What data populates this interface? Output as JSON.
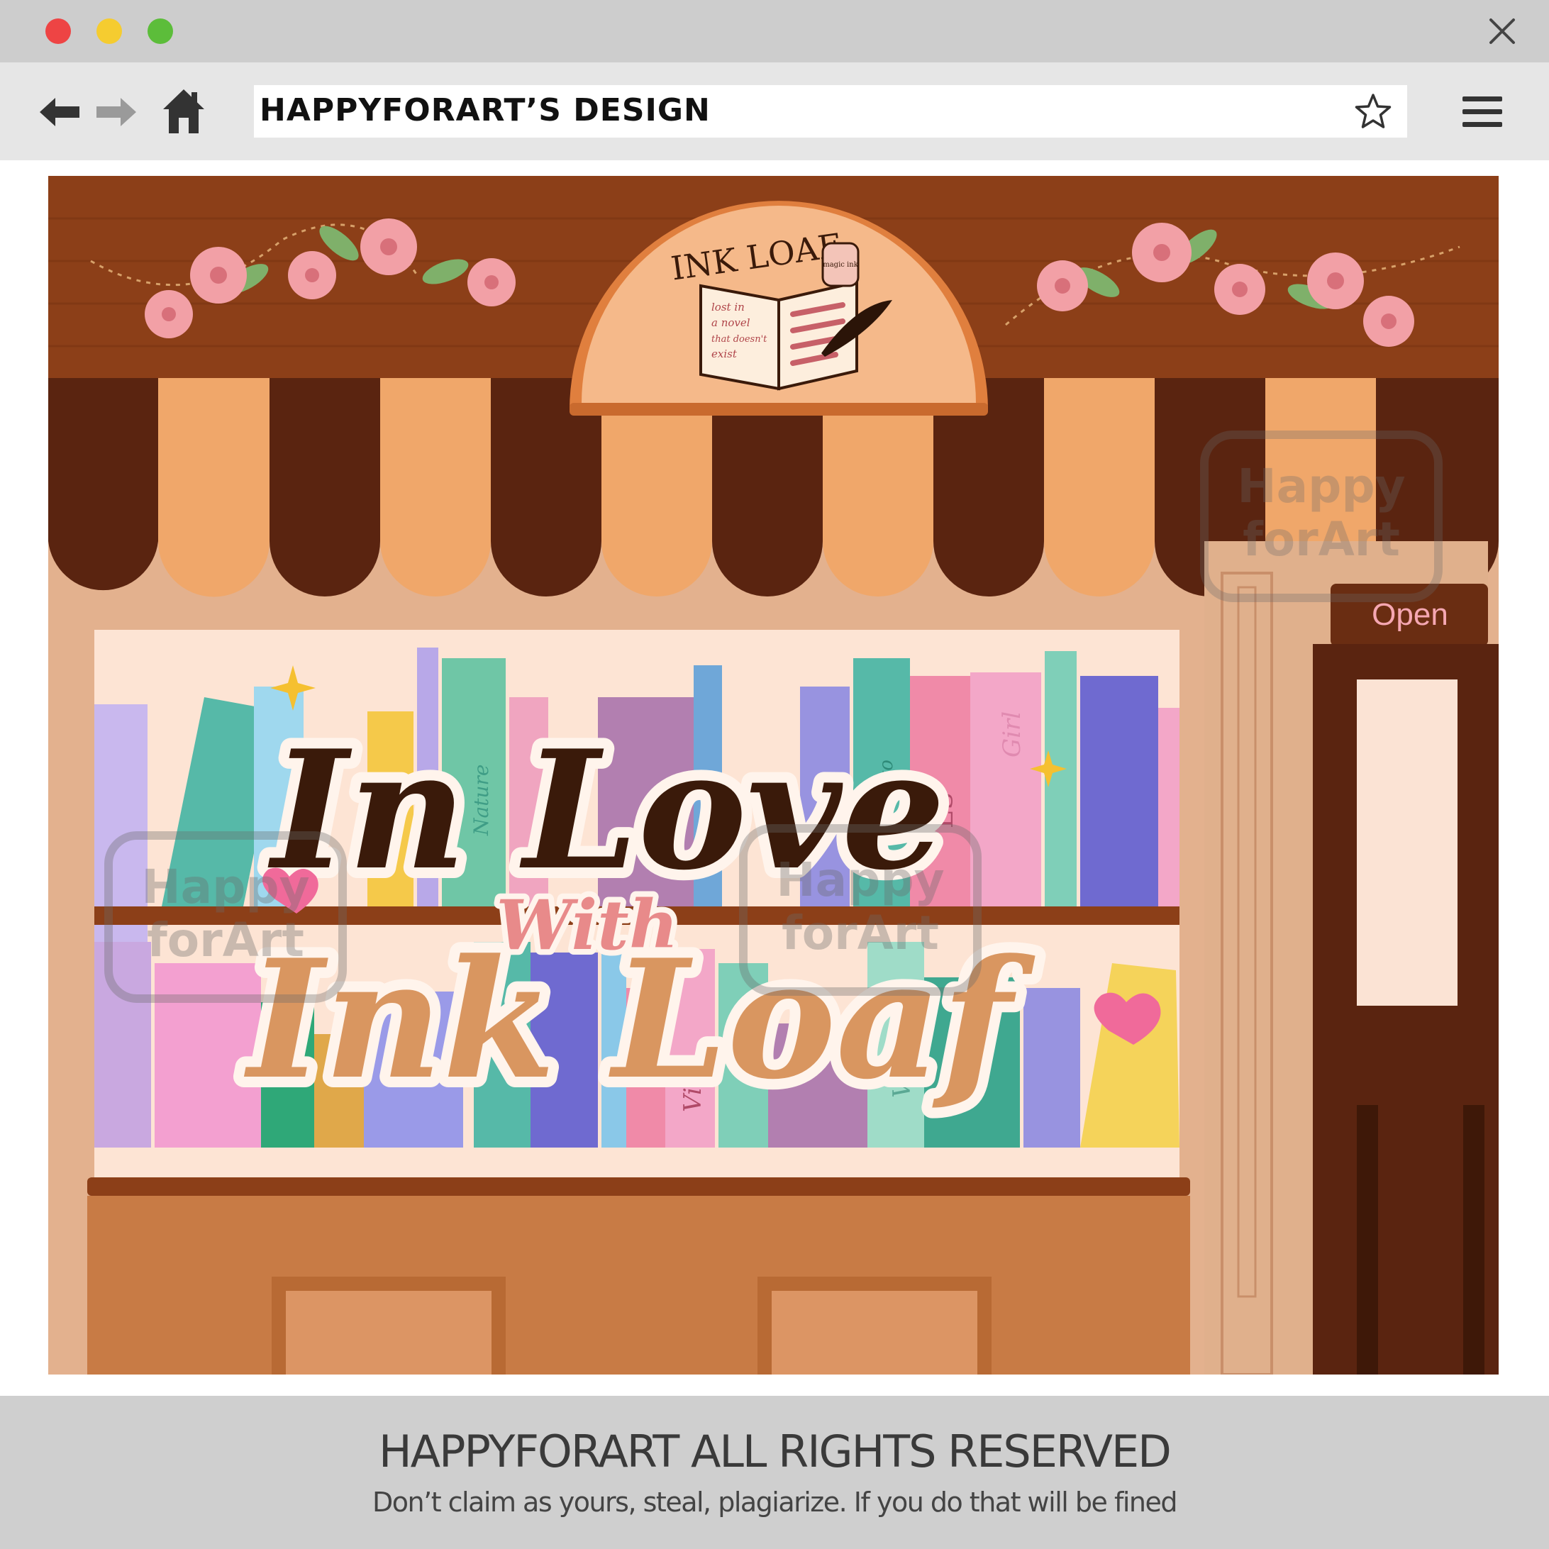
{
  "browser": {
    "address_title": "HAPPYFORART’S DESIGN",
    "icons": [
      "close-icon",
      "back-arrow-icon",
      "forward-arrow-icon",
      "home-icon",
      "star-icon",
      "hamburger-menu-icon"
    ],
    "window_buttons": {
      "close_color": "#ee4444",
      "minimize_color": "#f5cc30",
      "maximize_color": "#5cbd3a"
    }
  },
  "shop": {
    "sign_title": "INK LOAF",
    "sign_book_text": [
      "lost in",
      "a novel",
      "that doesn't",
      "exist"
    ],
    "jar_label": "magic ink",
    "open_sign": "Open",
    "headline_line1": "In Love",
    "headline_with": "With",
    "headline_line2": "Ink Loaf",
    "watermark_line1": "Happy",
    "watermark_line2": "forArt",
    "book_spine_labels": [
      "Nature",
      "Gusto",
      "ES",
      "Girl",
      "THE",
      "Vi",
      "Va"
    ]
  },
  "footer": {
    "title": "HAPPYFORART ALL RIGHTS RESERVED",
    "subtitle": "Don’t claim as yours, steal, plagiarize. If you do that will be fined"
  }
}
